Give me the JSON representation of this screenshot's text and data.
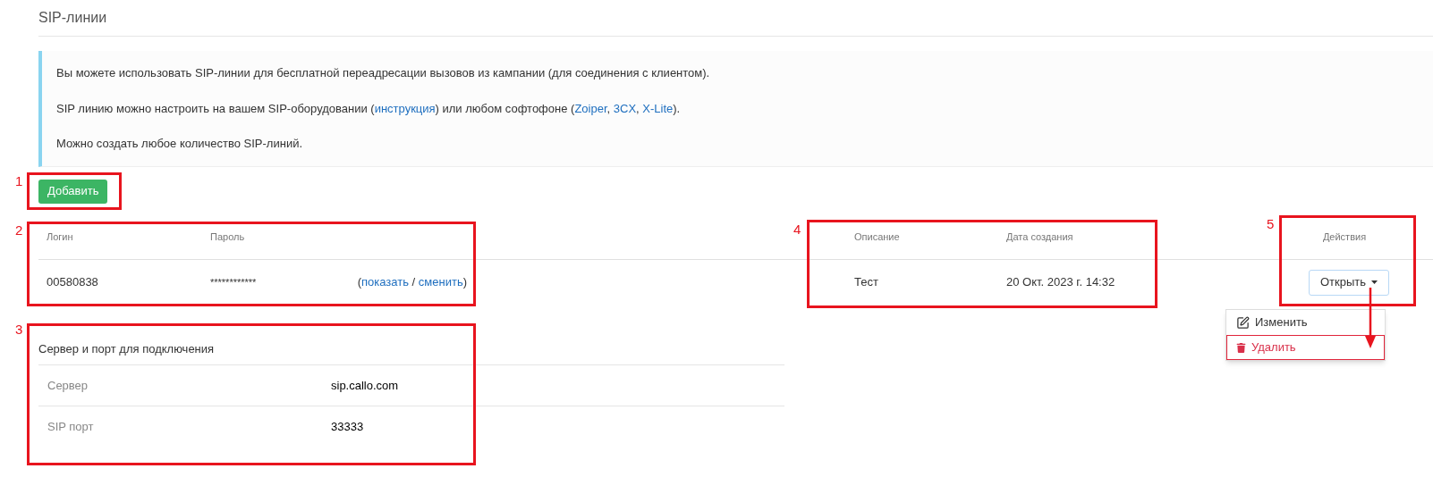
{
  "page_title": "SIP-линии",
  "info": [
    {
      "segments": [
        {
          "kind": "text",
          "text": "Вы можете использовать SIP-линии для бесплатной переадресации вызовов из кампании (для соединения с клиентом)."
        }
      ]
    },
    {
      "segments": [
        {
          "kind": "text",
          "text": "SIP линию можно настроить на вашем SIP-оборудовании ("
        },
        {
          "kind": "link",
          "text": "инструкция"
        },
        {
          "kind": "text",
          "text": ") или любом софтофоне ("
        },
        {
          "kind": "link",
          "text": "Zoiper"
        },
        {
          "kind": "text",
          "text": ", "
        },
        {
          "kind": "link",
          "text": "3CX"
        },
        {
          "kind": "text",
          "text": ", "
        },
        {
          "kind": "link",
          "text": "X-Lite"
        },
        {
          "kind": "text",
          "text": ")."
        }
      ]
    },
    {
      "segments": [
        {
          "kind": "text",
          "text": "Можно создать любое количество SIP-линий."
        }
      ]
    }
  ],
  "add_button": "Добавить",
  "table": {
    "columns": [
      "Логин",
      "Пароль",
      "Описание",
      "Дата создания",
      "Действия"
    ],
    "rows": [
      {
        "login": "00580838",
        "password": "************",
        "password_actions": [
          {
            "kind": "text",
            "text": "("
          },
          {
            "kind": "link",
            "text": "показать"
          },
          {
            "kind": "text",
            "text": " / "
          },
          {
            "kind": "link",
            "text": "сменить"
          },
          {
            "kind": "text",
            "text": ")"
          }
        ],
        "description": "Тест",
        "created": "20 Окт. 2023 г. 14:32",
        "action": "Открыть"
      }
    ]
  },
  "dropdown": {
    "items": [
      {
        "kind": "edit",
        "label": "Изменить",
        "outlined": false
      },
      {
        "kind": "delete",
        "label": "Удалить",
        "outlined": true
      }
    ]
  },
  "server": {
    "title": "Сервер и порт для подключения",
    "rows": [
      {
        "label": "Сервер",
        "value": "sip.callo.com"
      },
      {
        "label": "SIP порт",
        "value": "33333"
      }
    ]
  },
  "annotations": [
    {
      "label": "1"
    },
    {
      "label": "2"
    },
    {
      "label": "3"
    },
    {
      "label": "4"
    },
    {
      "label": "5"
    }
  ]
}
